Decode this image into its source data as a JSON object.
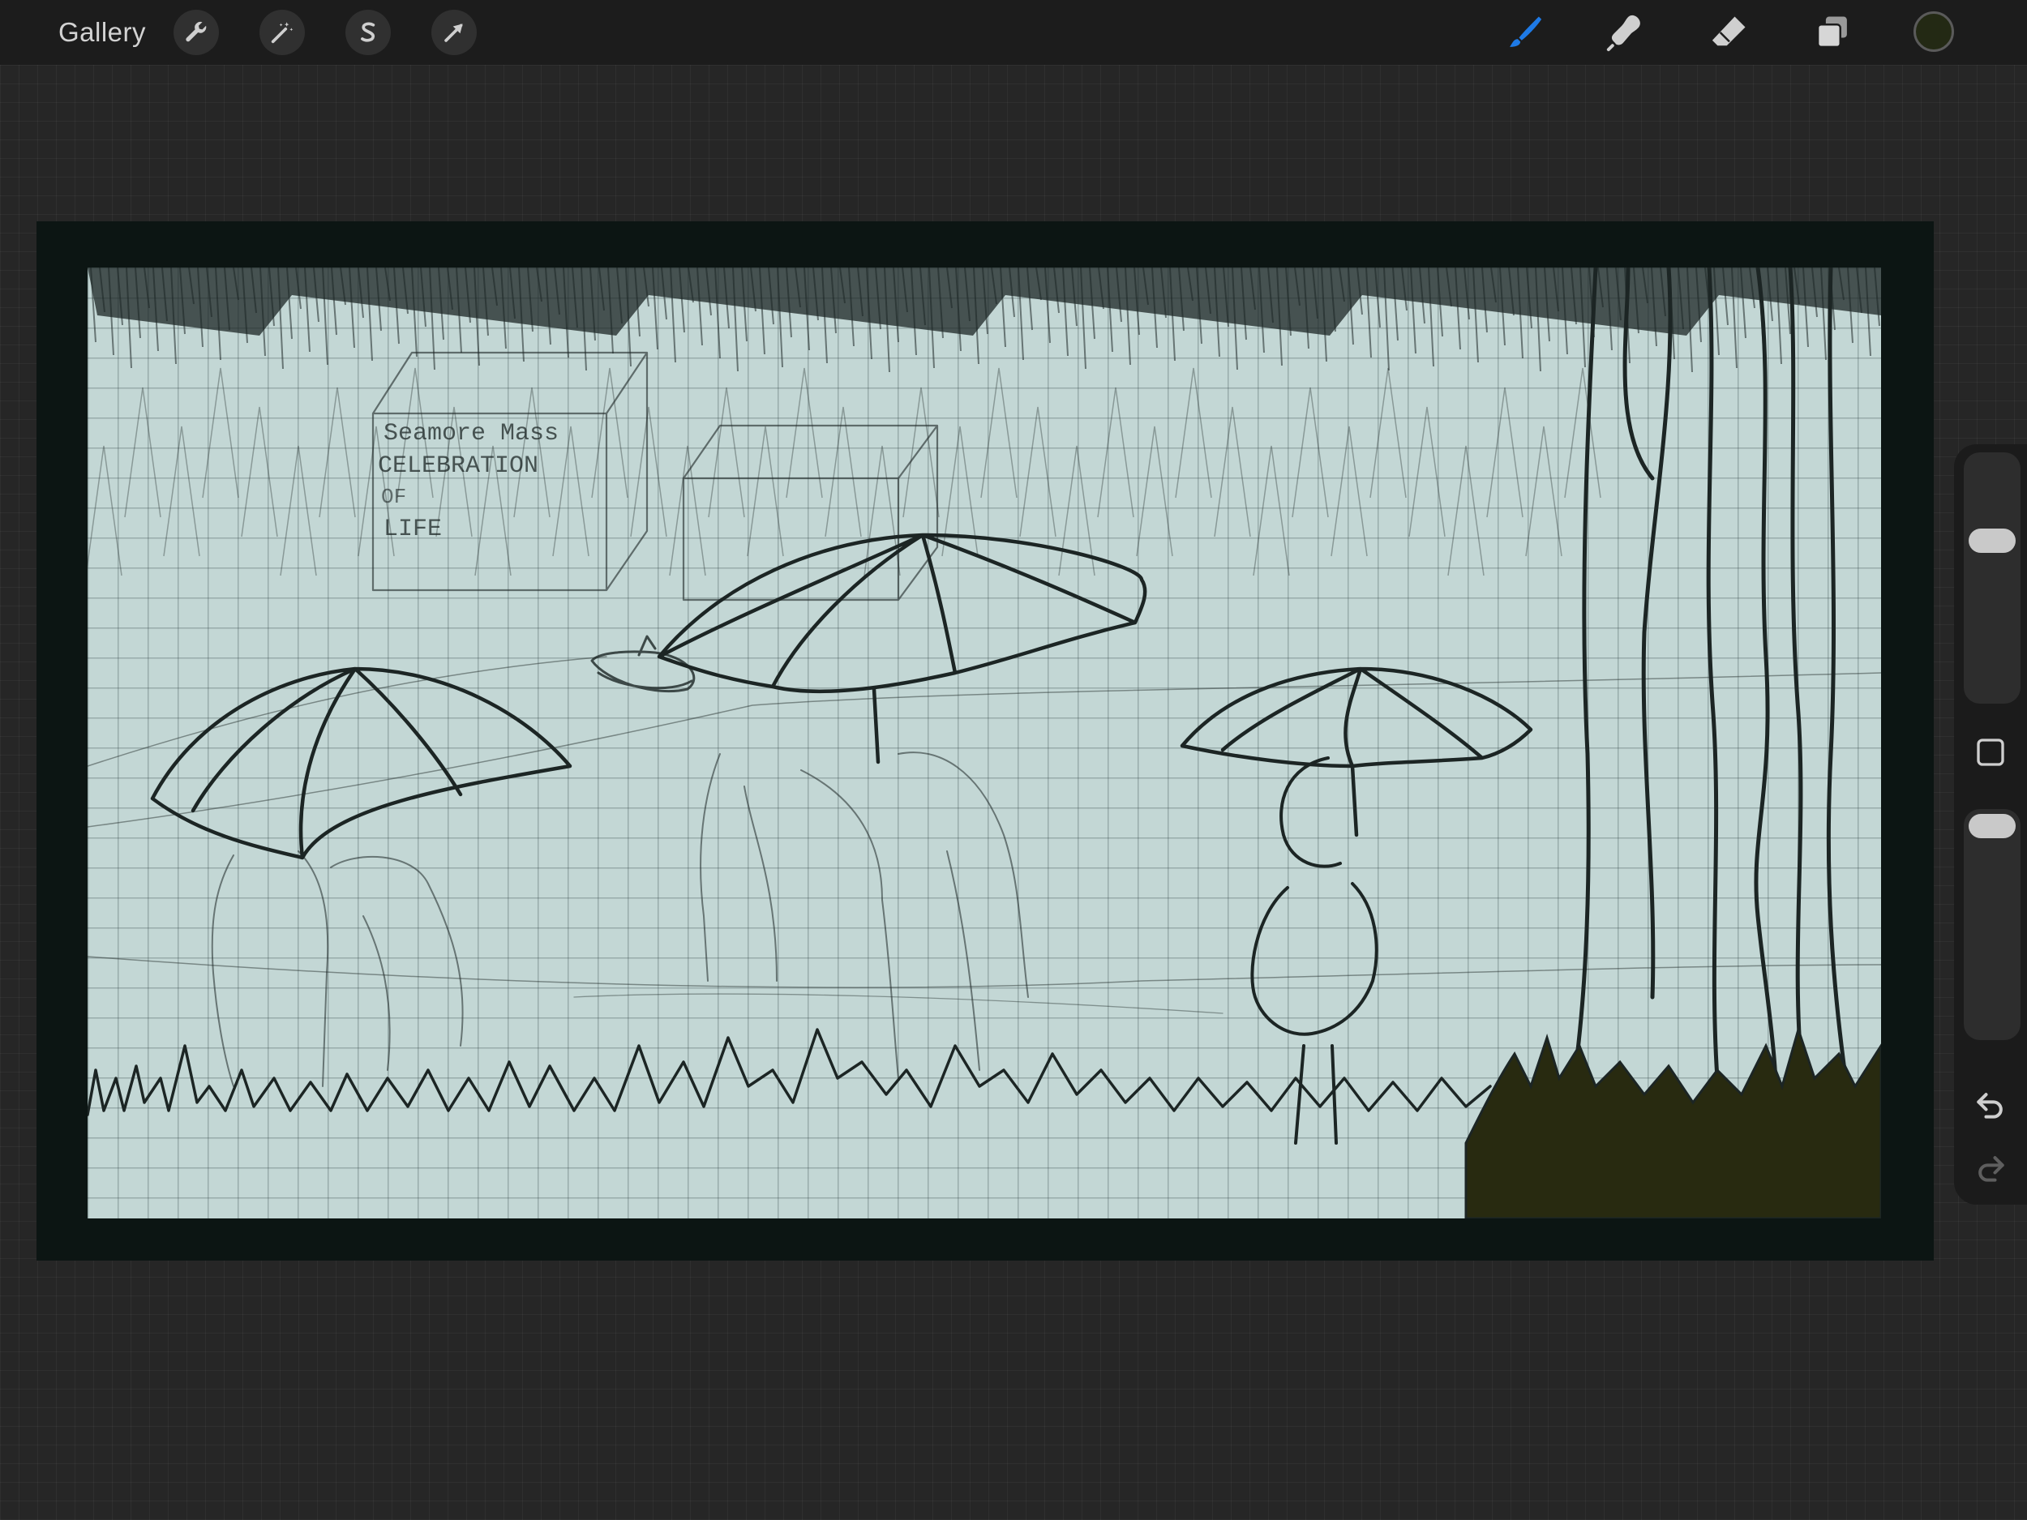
{
  "toolbar": {
    "gallery_label": "Gallery",
    "left_tools": [
      {
        "name": "actions",
        "icon": "wrench-icon"
      },
      {
        "name": "adjustments",
        "icon": "magic-wand-icon"
      },
      {
        "name": "selection",
        "icon": "selection-s-icon"
      },
      {
        "name": "transform",
        "icon": "arrow-cursor-icon"
      }
    ],
    "right_tools": [
      {
        "name": "paint",
        "icon": "brush-icon",
        "active": true
      },
      {
        "name": "smudge",
        "icon": "smudge-finger-icon"
      },
      {
        "name": "erase",
        "icon": "eraser-icon"
      },
      {
        "name": "layers",
        "icon": "layers-icon"
      }
    ],
    "current_color": "#232914",
    "active_color": "#1e7ae6"
  },
  "artwork": {
    "sign_lines": [
      "Seamore Mass",
      "CELEBRATION",
      "OF",
      "LIFE"
    ],
    "background_color": "#c3d7d5",
    "ink_color": "#1c2524",
    "grass_fill_color": "#282a10"
  },
  "sidebar": {
    "brush_size": 0.33,
    "brush_opacity": 0.0,
    "icons": [
      "square-modify-icon",
      "undo-icon",
      "redo-icon"
    ]
  }
}
